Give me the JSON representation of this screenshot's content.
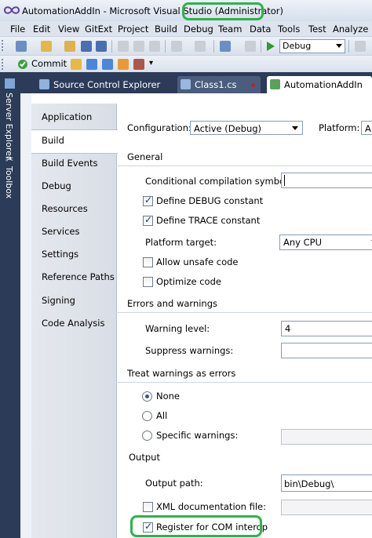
{
  "window": {
    "title": "AutomationAddIn - Microsoft Visual Studio",
    "admin_tag": "(Administrator)"
  },
  "menu": [
    "File",
    "Edit",
    "View",
    "GitExt",
    "Project",
    "Build",
    "Debug",
    "Team",
    "Data",
    "Tools",
    "Test",
    "Analyze"
  ],
  "toolbar": {
    "config_value": "Debug",
    "commit_label": "Commit"
  },
  "dock": {
    "server_explorer": "Server Explorer",
    "toolbox": "Toolbox"
  },
  "doc_tabs": [
    {
      "label": "Source Control Explorer"
    },
    {
      "label": "Class1.cs"
    },
    {
      "label": "AutomationAddIn"
    }
  ],
  "nav": [
    "Application",
    "Build",
    "Build Events",
    "Debug",
    "Resources",
    "Services",
    "Settings",
    "Reference Paths",
    "Signing",
    "Code Analysis"
  ],
  "nav_active": "Build",
  "config": {
    "configuration_label": "Configuration:",
    "configuration_value": "Active (Debug)",
    "platform_label": "Platform:",
    "platform_value": "A"
  },
  "general": {
    "header": "General",
    "conditional_label": "Conditional compilation symbols:",
    "conditional_value": "",
    "define_debug": "Define DEBUG constant",
    "define_trace": "Define TRACE constant",
    "platform_target_label": "Platform target:",
    "platform_target_value": "Any CPU",
    "allow_unsafe": "Allow unsafe code",
    "optimize": "Optimize code"
  },
  "errors": {
    "header": "Errors and warnings",
    "warning_level_label": "Warning level:",
    "warning_level_value": "4",
    "suppress_label": "Suppress warnings:",
    "suppress_value": ""
  },
  "treat": {
    "header": "Treat warnings as errors",
    "none": "None",
    "all": "All",
    "specific": "Specific warnings:",
    "selected": "None"
  },
  "output": {
    "header": "Output",
    "path_label": "Output path:",
    "path_value": "bin\\Debug\\",
    "xml_doc": "XML documentation file:",
    "register_com": "Register for COM interop"
  },
  "colors": {
    "highlight": "#2eb34a",
    "dock_bg": "#2b3b58"
  }
}
